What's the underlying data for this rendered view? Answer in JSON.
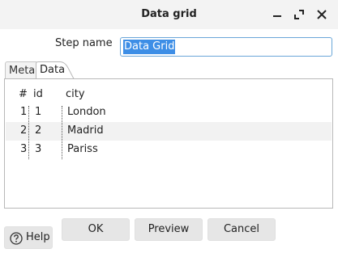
{
  "window": {
    "title": "Data grid"
  },
  "form": {
    "step_name_label": "Step name",
    "step_name_value": "Data Grid"
  },
  "tabs": [
    {
      "label": "Meta",
      "active": false
    },
    {
      "label": "Data",
      "active": true
    }
  ],
  "grid": {
    "columns": [
      "#",
      "id",
      "city"
    ],
    "rows": [
      {
        "num": "1",
        "id": "1",
        "city": "London"
      },
      {
        "num": "2",
        "id": "2",
        "city": "Madrid"
      },
      {
        "num": "3",
        "id": "3",
        "city": "Pariss"
      }
    ]
  },
  "buttons": {
    "ok": "OK",
    "preview": "Preview",
    "cancel": "Cancel",
    "help": "Help"
  },
  "colors": {
    "selection": "#3d8ee6",
    "focus_border": "#6aa6d8",
    "button_bg": "#e6e6e6"
  }
}
